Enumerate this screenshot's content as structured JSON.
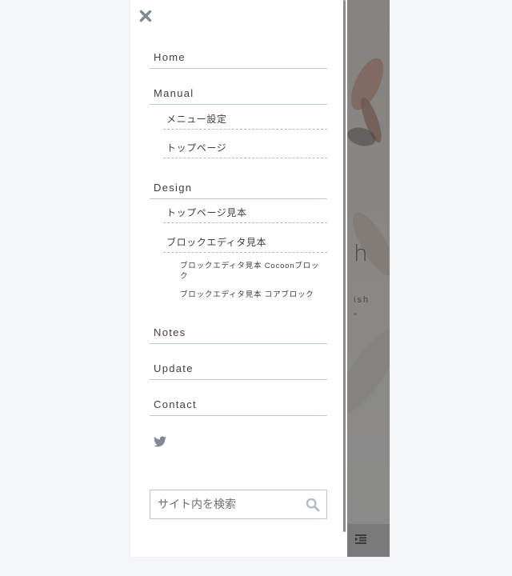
{
  "background_page": {
    "heading_fragment": "h",
    "text_fragment": "ish",
    "text_fragment2": "\""
  },
  "drawer": {
    "close_icon": "close-icon",
    "menu": [
      {
        "label": "Home"
      },
      {
        "label": "Manual",
        "children": [
          {
            "label": "メニュー設定"
          },
          {
            "label": "トップページ"
          }
        ]
      },
      {
        "label": "Design",
        "children": [
          {
            "label": "トップページ見本"
          },
          {
            "label": "ブロックエディタ見本",
            "children": [
              {
                "label": "ブロックエディタ見本 Cocoonブロック"
              },
              {
                "label": "ブロックエディタ見本 コアブロック"
              }
            ]
          }
        ]
      },
      {
        "label": "Notes"
      },
      {
        "label": "Update"
      },
      {
        "label": "Contact"
      }
    ],
    "social_icon": "twitter-icon",
    "search": {
      "placeholder": "サイト内を検索",
      "icon": "search-icon"
    }
  },
  "colors": {
    "accent_line": "#b9c7d1",
    "icon_gray": "#7f8a95",
    "overlay": "#6a6a6a"
  }
}
